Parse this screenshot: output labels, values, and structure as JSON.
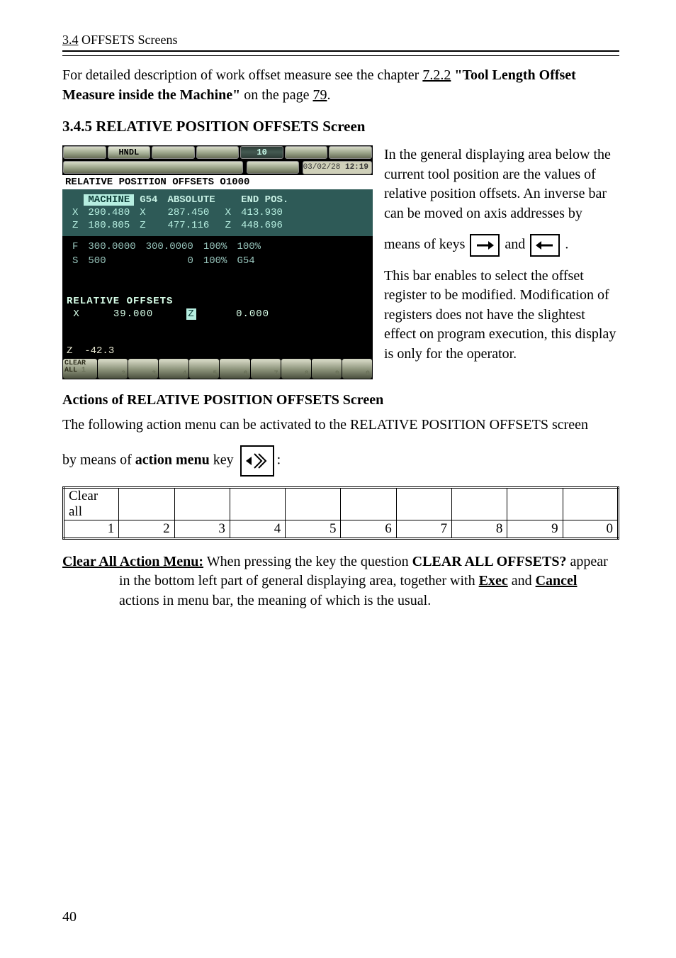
{
  "header": {
    "section_ref": "3.4",
    "section_title": "OFFSETS Screens"
  },
  "intro": {
    "before": "For detailed description of work offset measure see the chapter ",
    "link": "7.2.2",
    "bold": " \"Tool Length Offset Measure inside the Machine\"",
    "mid": " on the page ",
    "page_link": "79",
    "after": "."
  },
  "section_345": "3.4.5 RELATIVE POSITION OFFSETS Screen",
  "cnc": {
    "topbar": {
      "hndl": "HNDL",
      "ten": "10"
    },
    "datetime": {
      "date": "03/02/28",
      "time": "12:19"
    },
    "title": "RELATIVE POSITION OFFSETS O1000",
    "headers": {
      "machine": "MACHINE",
      "g54": "G54",
      "abs": "ABSOLUTE",
      "end": "END POS."
    },
    "x": {
      "m": "290.480",
      "a": "287.450",
      "e": "413.930"
    },
    "z": {
      "m": "180.805",
      "a": "477.116",
      "e": "448.696"
    },
    "f": {
      "label": "F",
      "v1": "300.0000",
      "v2": "300.0000",
      "p": "100%",
      "p2": "100%"
    },
    "s": {
      "label": "S",
      "v1": "500",
      "v2": "0",
      "p": "100%",
      "g": "G54"
    },
    "rel_title": "RELATIVE OFFSETS",
    "rel": {
      "x": "39.000",
      "z": "0.000",
      "zlabel": "Z"
    },
    "rapid": {
      "label": "Z",
      "val": "-42.3"
    },
    "menu": {
      "clear": "CLEAR",
      "all": "ALL"
    }
  },
  "right": {
    "p1": "In the general displaying area below the current tool position are the values of relative position offsets. An inverse bar can be moved on axis addresses by",
    "p2a": "means of keys ",
    "p2b": " and ",
    "p2c": ".",
    "p3": "This bar enables to select the offset register to be modified. Modification of registers does not have the slightest effect on program execution, this display is only for the operator."
  },
  "actions_title": "Actions of RELATIVE POSITION OFFSETS Screen",
  "actions_intro": "The following action menu can be activated to the RELATIVE POSITION OFFSETS screen",
  "actions_by_a": "by means of ",
  "actions_by_b": "action menu",
  "actions_by_c": " key ",
  "menu_table": {
    "label": "Clear all",
    "cells": [
      "1",
      "2",
      "3",
      "4",
      "5",
      "6",
      "7",
      "8",
      "9",
      "0"
    ]
  },
  "clear_all": {
    "title": "Clear All Action Menu:",
    "body1": " When pressing the key the question ",
    "q": "CLEAR ALL OFFSETS?",
    "body2": " appear in the bottom left part of general displaying area, together with ",
    "exec": "Exec",
    "and": " and ",
    "cancel": "Cancel",
    "body3": " actions in menu bar, the meaning of which is the usual."
  },
  "page_number": "40"
}
